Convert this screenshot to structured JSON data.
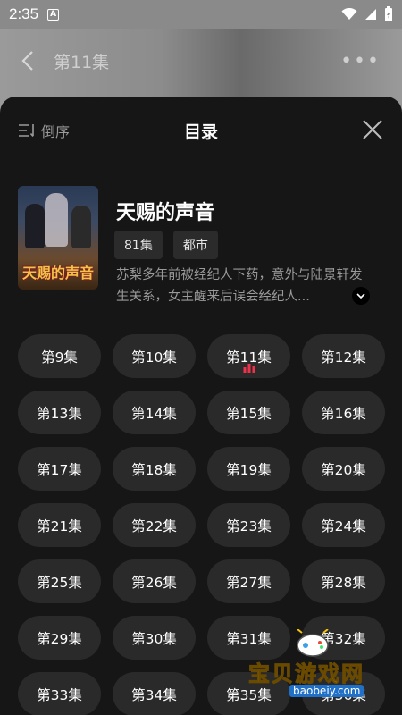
{
  "status": {
    "time": "2:35",
    "notif": "A"
  },
  "nav": {
    "episode": "第11集"
  },
  "panel": {
    "sort_label": "倒序",
    "title": "目录"
  },
  "drama": {
    "poster_title": "天赐的声音",
    "title": "天赐的声音",
    "tags": [
      "81集",
      "都市"
    ],
    "desc": "苏梨多年前被经纪人下药，意外与陆景轩发生关系，女主醒来后误会经纪人..."
  },
  "episodes": [
    "第9集",
    "第10集",
    "第11集",
    "第12集",
    "第13集",
    "第14集",
    "第15集",
    "第16集",
    "第17集",
    "第18集",
    "第19集",
    "第20集",
    "第21集",
    "第22集",
    "第23集",
    "第24集",
    "第25集",
    "第26集",
    "第27集",
    "第28集",
    "第29集",
    "第30集",
    "第31集",
    "第32集",
    "第33集",
    "第34集",
    "第35集",
    "第36集"
  ],
  "current_episode": "第11集",
  "watermark": {
    "text": "宝贝游戏网",
    "url": "baobeiy.com"
  },
  "colors": {
    "panel_bg": "#161616",
    "button_bg": "#2a2a2a",
    "playing_indicator": "#f0314b"
  }
}
